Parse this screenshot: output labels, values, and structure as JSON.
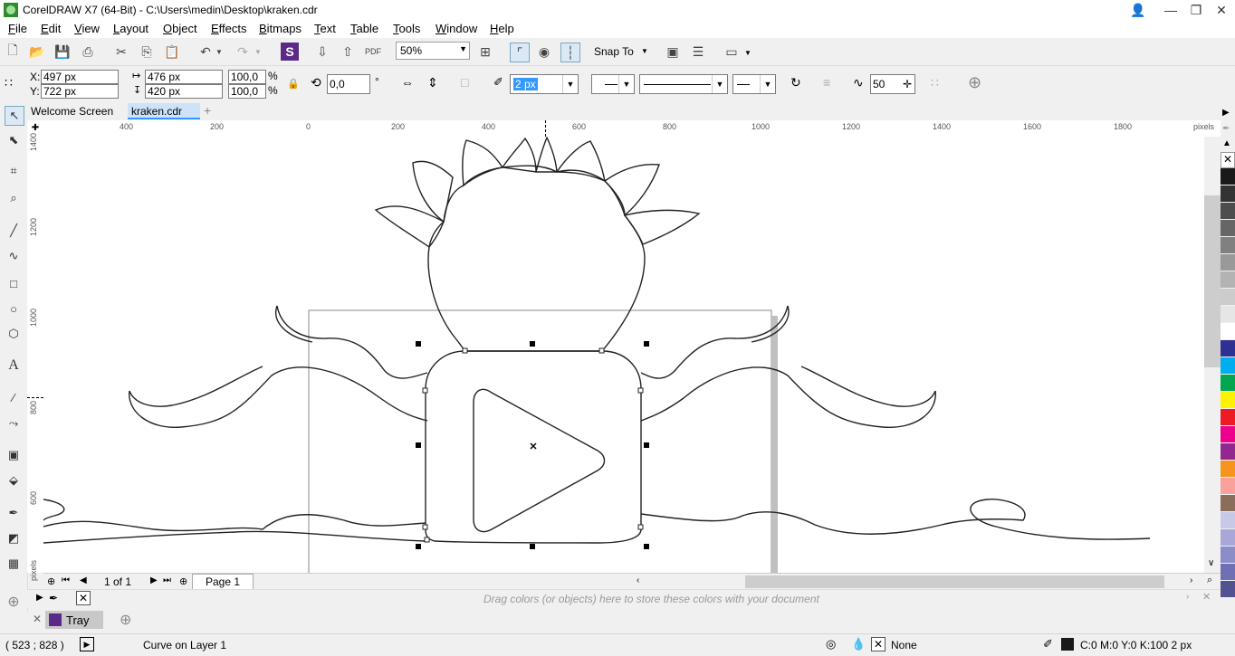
{
  "window": {
    "title": "CorelDRAW X7 (64-Bit) - C:\\Users\\medin\\Desktop\\kraken.cdr"
  },
  "menu": [
    "File",
    "Edit",
    "View",
    "Layout",
    "Object",
    "Effects",
    "Bitmaps",
    "Text",
    "Table",
    "Tools",
    "Window",
    "Help"
  ],
  "toolbar": {
    "zoom": "50%",
    "snap_to": "Snap To"
  },
  "properties": {
    "x_label": "X:",
    "x_value": "497 px",
    "y_label": "Y:",
    "y_value": "722 px",
    "width_value": "476 px",
    "height_value": "420 px",
    "scale_w": "100,0",
    "scale_h": "100,0",
    "percent": "%",
    "rotation": "0,0",
    "degree": "°",
    "outline_width": "2 px",
    "smoothing": "50"
  },
  "tabs": [
    "Welcome Screen",
    "kraken.cdr"
  ],
  "ruler_h_labels": [
    "400",
    "200",
    "0",
    "200",
    "400",
    "600",
    "800",
    "1000",
    "1200",
    "1400",
    "1600",
    "1800"
  ],
  "ruler_unit": "pixels",
  "ruler_v_labels": [
    "1400",
    "1200",
    "1000",
    "800",
    "600"
  ],
  "page_nav": {
    "count": "1 of 1",
    "page_tab": "Page 1"
  },
  "doc_palette_hint": "Drag colors (or objects) here to store these colors with your document",
  "tray_label": "Tray",
  "status": {
    "coords": "( 523  ; 828  )",
    "object_info": "Curve on Layer 1",
    "fill": "None",
    "outline": "C:0 M:0 Y:0 K:100  2 px"
  },
  "colors": {
    "accent": "#3399ff",
    "palette": [
      "#1a1a1a",
      "#333333",
      "#4d4d4d",
      "#666666",
      "#808080",
      "#999999",
      "#b3b3b3",
      "#cccccc",
      "#e6e6e6",
      "#ffffff",
      "#2e3192",
      "#00aeef",
      "#00a651",
      "#fff200",
      "#ed1c24",
      "#ec008c",
      "#92278f",
      "#f7941d",
      "#f9a19a",
      "#8b6d5c",
      "#c8c8e8",
      "#a8a8d8",
      "#8c8cc8",
      "#6f6fb4",
      "#525290",
      "#3a3a70"
    ]
  }
}
